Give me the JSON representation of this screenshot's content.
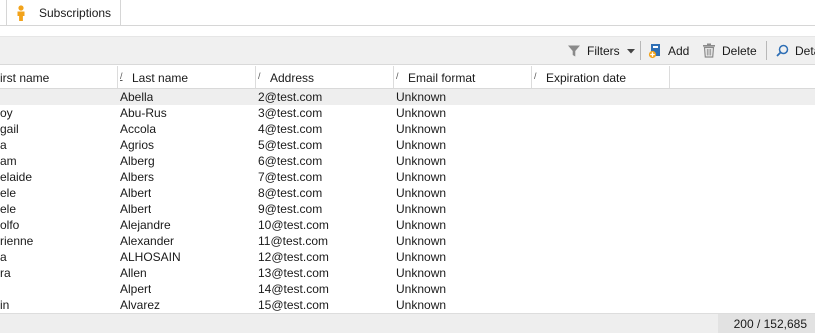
{
  "tab": {
    "label": "Subscriptions",
    "icon": "person-icon",
    "icon_color": "#f2a31b"
  },
  "toolbar": {
    "filters_label": "Filters",
    "add_label": "Add",
    "delete_label": "Delete",
    "detail_label": "Deta"
  },
  "columns": {
    "first_name": "irst name",
    "last_name": "Last name",
    "address": "Address",
    "email_format": "Email format",
    "expiration_date": "Expiration date"
  },
  "rows": [
    {
      "first": "",
      "last": "Abella",
      "address": "2@test.com",
      "format": "Unknown"
    },
    {
      "first": "oy",
      "last": "Abu-Rus",
      "address": "3@test.com",
      "format": "Unknown"
    },
    {
      "first": "gail",
      "last": "Accola",
      "address": "4@test.com",
      "format": "Unknown"
    },
    {
      "first": "a",
      "last": "Agrios",
      "address": "5@test.com",
      "format": "Unknown"
    },
    {
      "first": "am",
      "last": "Alberg",
      "address": "6@test.com",
      "format": "Unknown"
    },
    {
      "first": "elaide",
      "last": "Albers",
      "address": "7@test.com",
      "format": "Unknown"
    },
    {
      "first": "ele",
      "last": "Albert",
      "address": "8@test.com",
      "format": "Unknown"
    },
    {
      "first": "ele",
      "last": "Albert",
      "address": "9@test.com",
      "format": "Unknown"
    },
    {
      "first": "olfo",
      "last": "Alejandre",
      "address": "10@test.com",
      "format": "Unknown"
    },
    {
      "first": "rienne",
      "last": "Alexander",
      "address": "11@test.com",
      "format": "Unknown"
    },
    {
      "first": "a",
      "last": "ALHOSAIN",
      "address": "12@test.com",
      "format": "Unknown"
    },
    {
      "first": "ra",
      "last": "Allen",
      "address": "13@test.com",
      "format": "Unknown"
    },
    {
      "first": "",
      "last": "Alpert",
      "address": "14@test.com",
      "format": "Unknown"
    },
    {
      "first": "in",
      "last": "Alvarez",
      "address": "15@test.com",
      "format": "Unknown"
    }
  ],
  "status": {
    "count": "200 / 152,685"
  }
}
